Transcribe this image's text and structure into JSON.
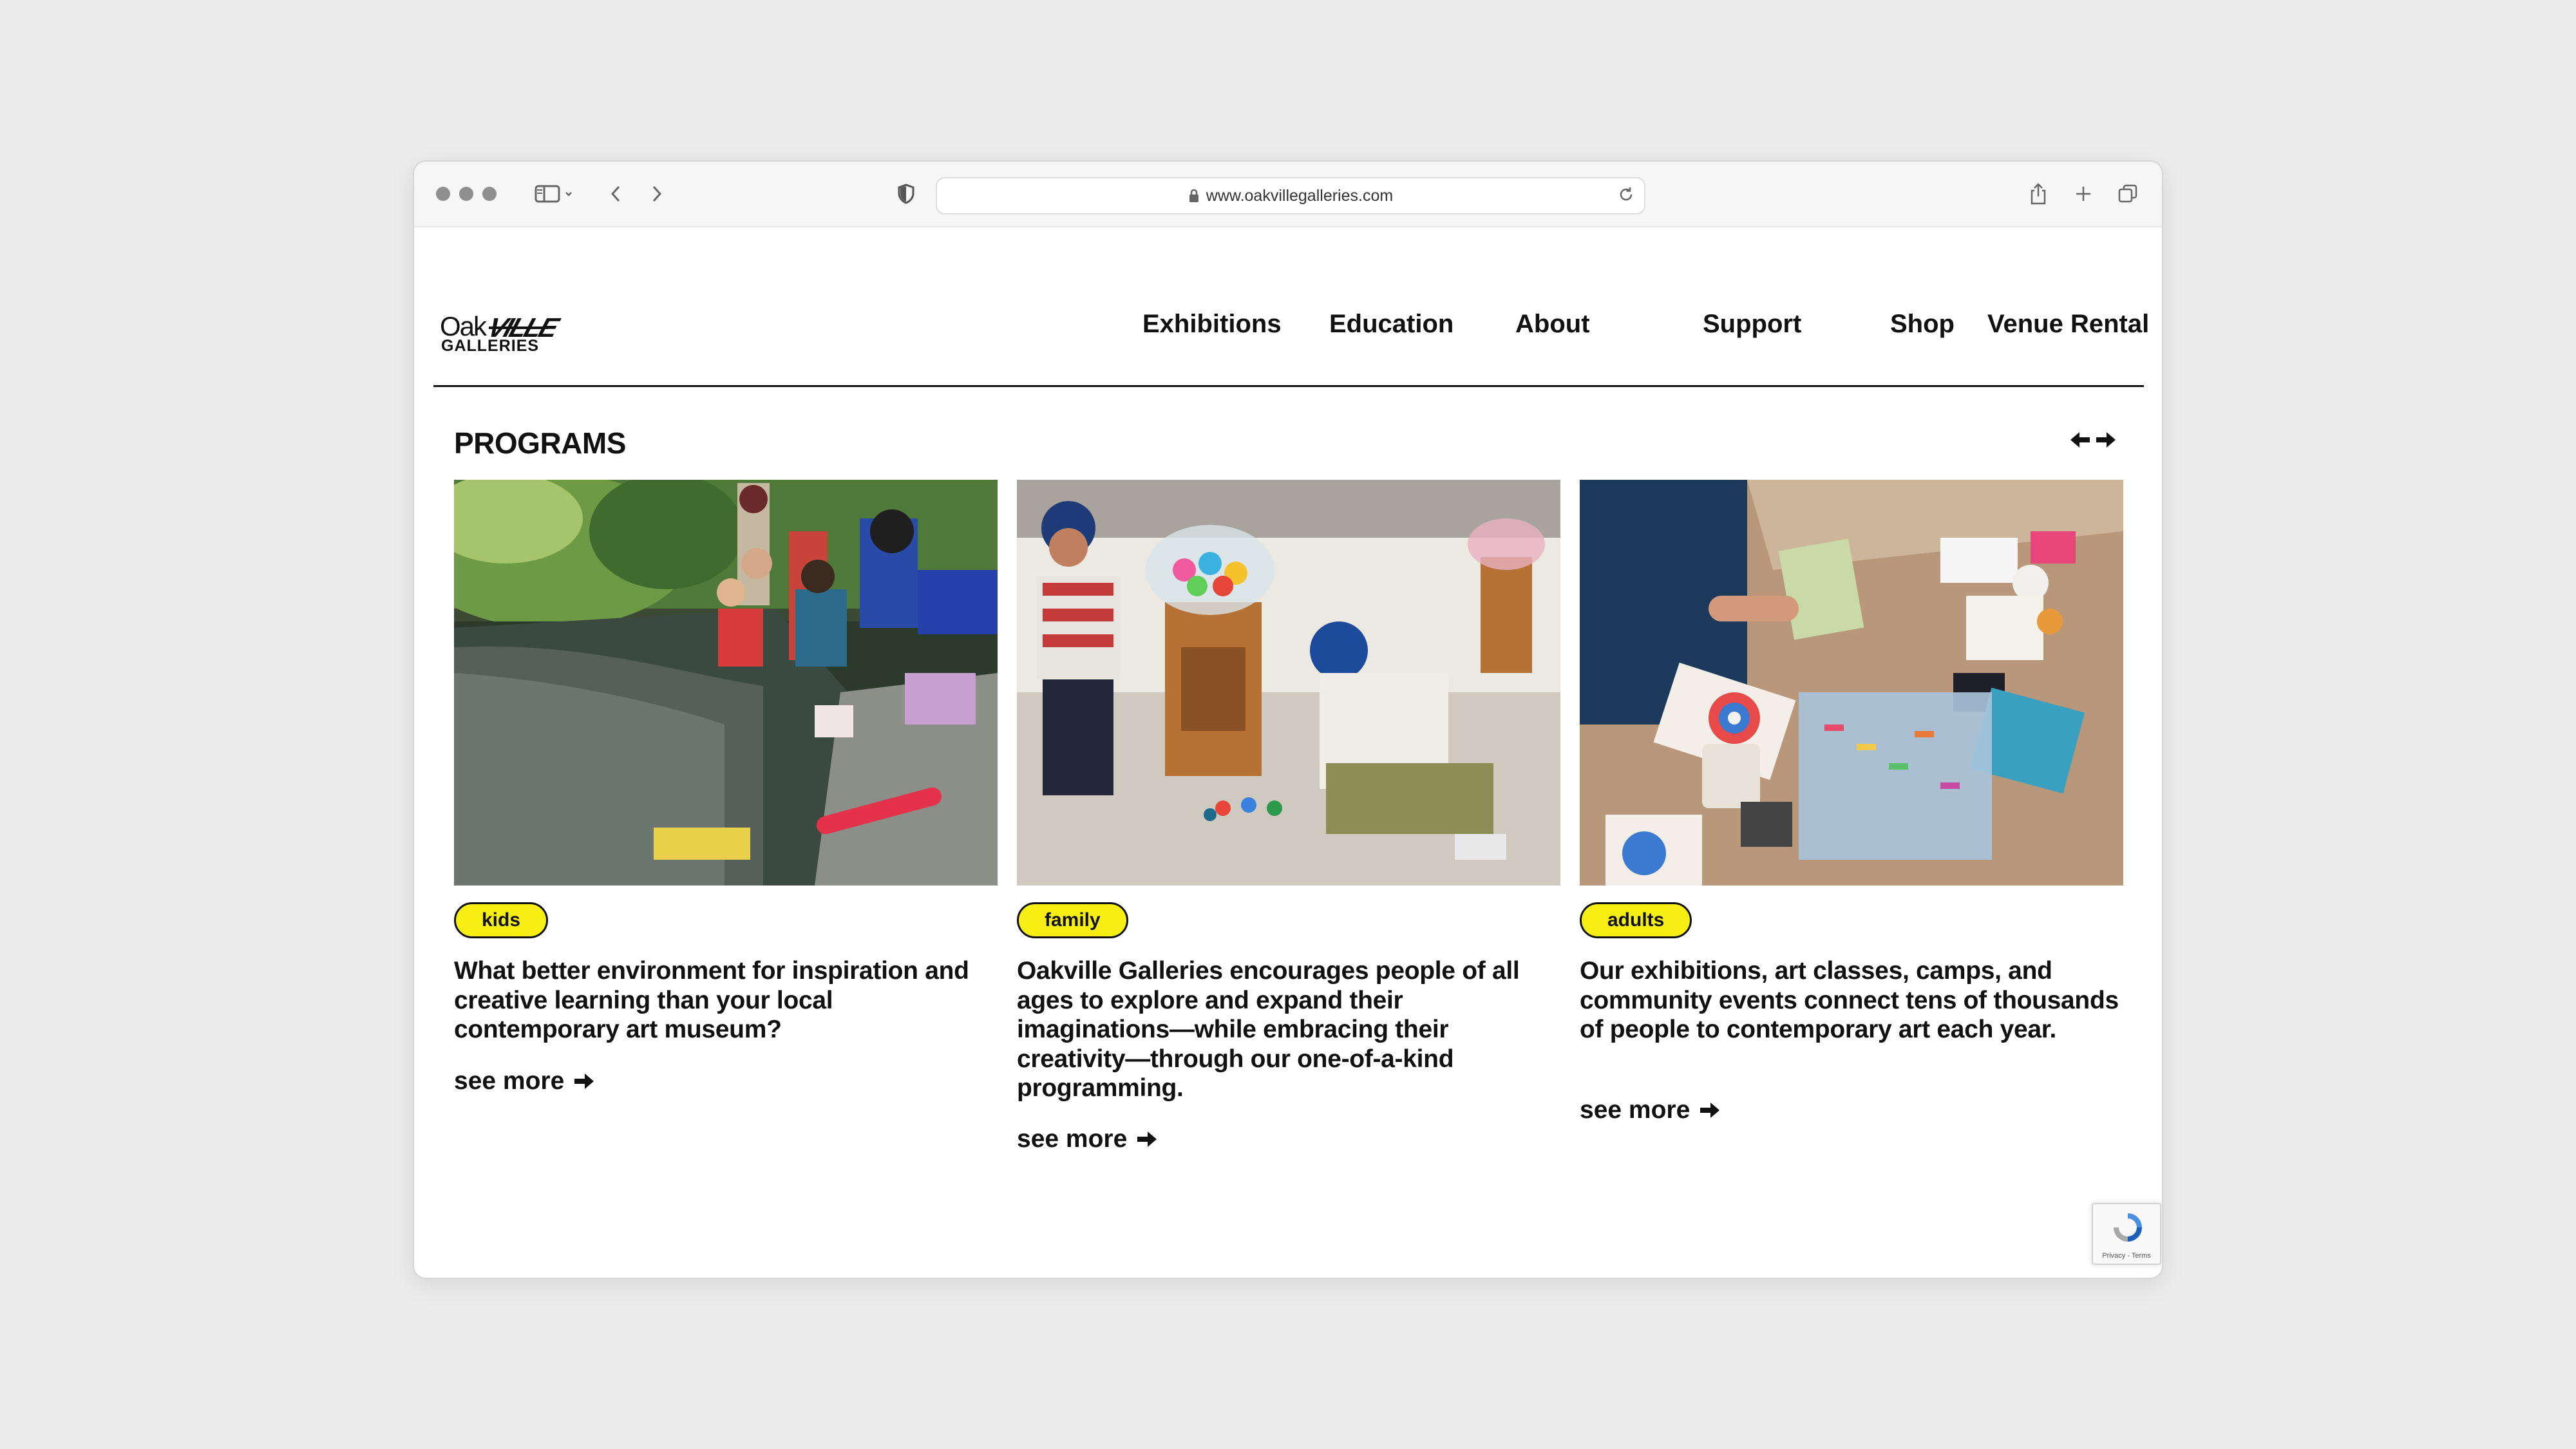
{
  "browser": {
    "url": "www.oakvillegalleries.com"
  },
  "site": {
    "logo": {
      "line1_a": "Oak",
      "line1_b": "VILLE",
      "line2": "GALLERIES"
    },
    "nav": [
      {
        "label": "Exhibitions"
      },
      {
        "label": "Education"
      },
      {
        "label": "About"
      },
      {
        "label": "Support"
      },
      {
        "label": "Shop"
      },
      {
        "label": "Venue Rental"
      }
    ]
  },
  "programs": {
    "title": "PROGRAMS",
    "cards": [
      {
        "tag": "kids",
        "image": "children at a pond edge floating handmade boats",
        "description": "What better environment for inspiration and creative learning than your local contemporary art museum?",
        "link": "see more"
      },
      {
        "tag": "family",
        "image": "kids building with colourful pompoms in a gallery",
        "description": "Oakville Galleries encourages people of all ages to explore and expand their imaginations—while embracing their creativity—through our one-of-a-kind programming.",
        "link": "see more"
      },
      {
        "tag": "adults",
        "image": "art class table with pastels and colour wheels",
        "description": "Our exhibitions, art classes, camps, and community events connect tens of thousands of people to contemporary art each year.",
        "link": "see more"
      }
    ]
  },
  "recaptcha": {
    "text": "Privacy - Terms"
  },
  "colors": {
    "accent_yellow": "#f7ef13",
    "text": "#111111",
    "background": "#ffffff"
  }
}
